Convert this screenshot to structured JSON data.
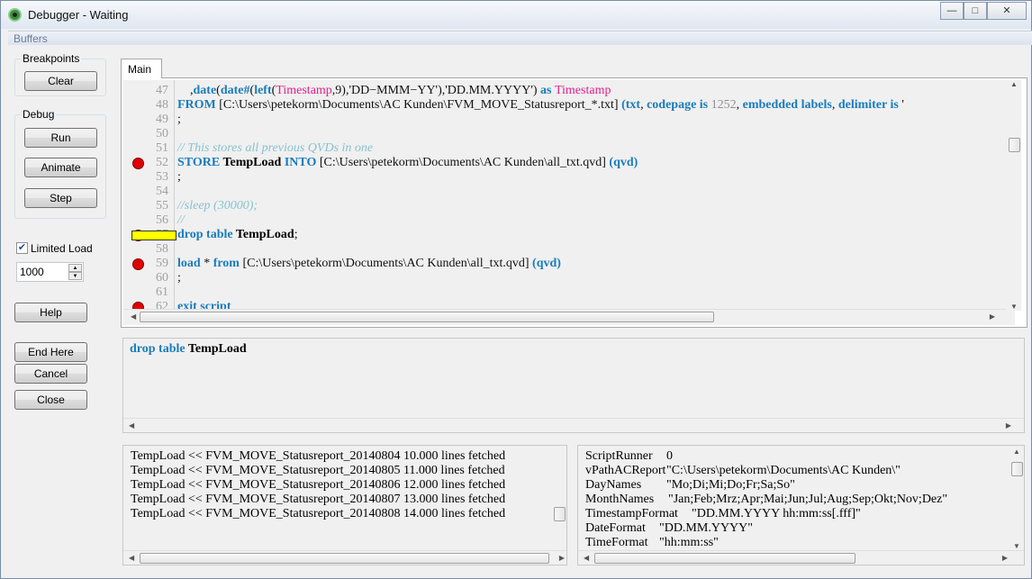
{
  "window": {
    "title": "Debugger - Waiting",
    "controls": [
      "—",
      "□",
      "✕"
    ]
  },
  "menu": {
    "buffers": "Buffers"
  },
  "breakpoints": {
    "label": "Breakpoints",
    "clear": "Clear"
  },
  "debug": {
    "label": "Debug",
    "run": "Run",
    "animate": "Animate",
    "step": "Step"
  },
  "limited_load": {
    "label": "Limited Load",
    "checked": true,
    "value": "1000"
  },
  "buttons": {
    "help": "Help",
    "end_here": "End Here",
    "cancel": "Cancel",
    "close": "Close"
  },
  "tabs": [
    {
      "label": "Main",
      "active": true
    }
  ],
  "editor": {
    "current_line": 57,
    "breakpoints": [
      52,
      57,
      59,
      62
    ],
    "lines": [
      {
        "n": "47",
        "t": [
          [
            "pl",
            "    ,"
          ],
          [
            "kw",
            "date"
          ],
          [
            "pl",
            "("
          ],
          [
            "kw",
            "date#"
          ],
          [
            "pl",
            "("
          ],
          [
            "kw",
            "left"
          ],
          [
            "pl",
            "("
          ],
          [
            "fn",
            "Timestamp"
          ],
          [
            "pl",
            ",9),'DD−MMM−YY'),'DD.MM.YYYY') "
          ],
          [
            "kw",
            "as "
          ],
          [
            "fn",
            "Timestamp"
          ]
        ]
      },
      {
        "n": "48",
        "t": [
          [
            "kw",
            "FROM "
          ],
          [
            "pl",
            "[C:\\Users\\petekorm\\Documents\\AC Kunden\\FVM_MOVE_Statusreport_*.txt] "
          ],
          [
            "kw",
            "(txt"
          ],
          [
            "pl",
            ", "
          ],
          [
            "kw",
            "codepage is "
          ],
          [
            "num",
            "1252"
          ],
          [
            "pl",
            ", "
          ],
          [
            "kw",
            "embedded labels"
          ],
          [
            "pl",
            ", "
          ],
          [
            "kw",
            "delimiter is "
          ],
          [
            "pl",
            "'"
          ]
        ]
      },
      {
        "n": "49",
        "t": [
          [
            "pl",
            ";"
          ]
        ]
      },
      {
        "n": "50",
        "t": []
      },
      {
        "n": "51",
        "t": [
          [
            "cm",
            "// This stores all previous QVDs in one"
          ]
        ]
      },
      {
        "n": "52",
        "t": [
          [
            "kw",
            "STORE "
          ],
          [
            "tb",
            "TempLoad "
          ],
          [
            "kw",
            "INTO "
          ],
          [
            "pl",
            "[C:\\Users\\petekorm\\Documents\\AC Kunden\\all_txt.qvd] "
          ],
          [
            "kw",
            "(qvd)"
          ]
        ]
      },
      {
        "n": "53",
        "t": [
          [
            "pl",
            ";"
          ]
        ]
      },
      {
        "n": "54",
        "t": []
      },
      {
        "n": "55",
        "t": [
          [
            "cm",
            "//sleep (30000);"
          ]
        ]
      },
      {
        "n": "56",
        "t": [
          [
            "cm",
            "//"
          ]
        ]
      },
      {
        "n": "57",
        "t": [
          [
            "kw",
            "drop table "
          ],
          [
            "tb",
            "TempLoad"
          ],
          [
            "pl",
            ";"
          ]
        ]
      },
      {
        "n": "58",
        "t": []
      },
      {
        "n": "59",
        "t": [
          [
            "kw",
            "load "
          ],
          [
            "pl",
            "* "
          ],
          [
            "kw",
            "from "
          ],
          [
            "pl",
            "[C:\\Users\\petekorm\\Documents\\AC Kunden\\all_txt.qvd] "
          ],
          [
            "kw",
            "(qvd)"
          ]
        ]
      },
      {
        "n": "60",
        "t": [
          [
            "pl",
            ";"
          ]
        ]
      },
      {
        "n": "61",
        "t": []
      },
      {
        "n": "62",
        "t": [
          [
            "kw",
            "exit script"
          ]
        ]
      }
    ]
  },
  "current_statement": {
    "keyword": "drop table ",
    "table": "TempLoad"
  },
  "log": [
    "TempLoad << FVM_MOVE_Statusreport_20140804 10.000 lines fetched",
    "TempLoad << FVM_MOVE_Statusreport_20140805 11.000 lines fetched",
    "TempLoad << FVM_MOVE_Statusreport_20140806 12.000 lines fetched",
    "TempLoad << FVM_MOVE_Statusreport_20140807 13.000 lines fetched",
    "TempLoad << FVM_MOVE_Statusreport_20140808 14.000 lines fetched"
  ],
  "variables": [
    {
      "name": "ScriptRunner",
      "value": "0"
    },
    {
      "name": "vPathACReport",
      "value": "\"C:\\Users\\petekorm\\Documents\\AC Kunden\\\""
    },
    {
      "name": "DayNames",
      "value": "\"Mo;Di;Mi;Do;Fr;Sa;So\""
    },
    {
      "name": "MonthNames",
      "value": "\"Jan;Feb;Mrz;Apr;Mai;Jun;Jul;Aug;Sep;Okt;Nov;Dez\""
    },
    {
      "name": "TimestampFormat",
      "value": "\"DD.MM.YYYY hh:mm:ss[.fff]\""
    },
    {
      "name": "DateFormat",
      "value": "\"DD.MM.YYYY\""
    },
    {
      "name": "TimeFormat",
      "value": "\"hh:mm:ss\""
    }
  ]
}
